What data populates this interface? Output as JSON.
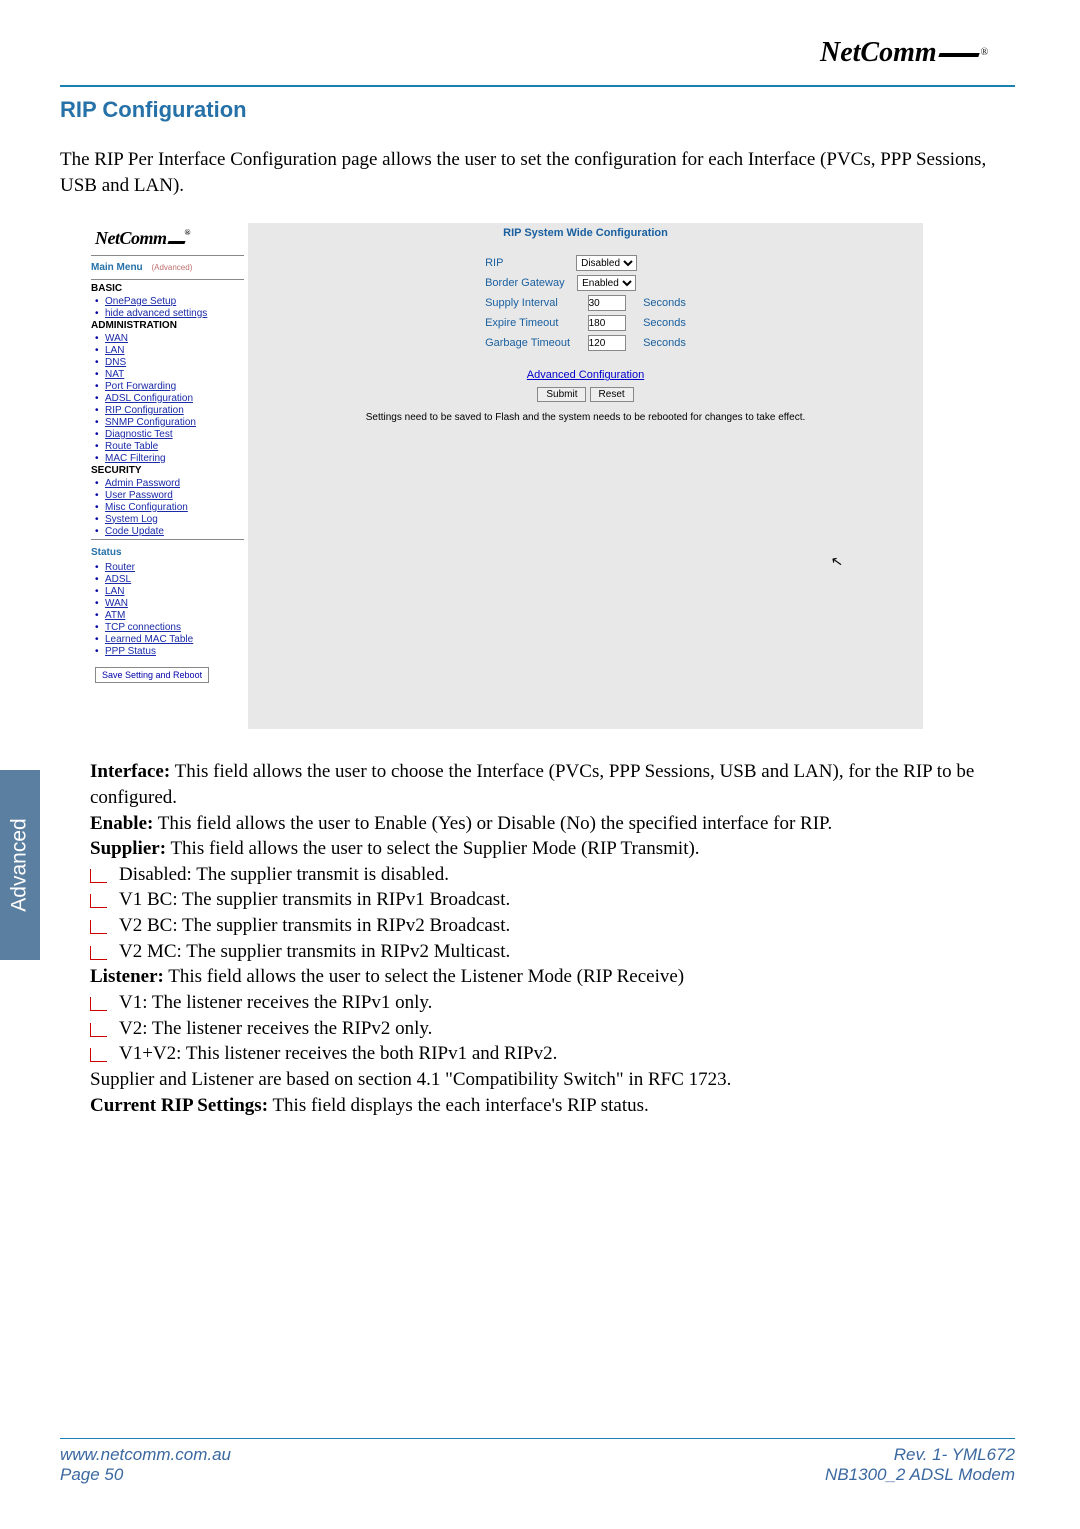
{
  "header": {
    "logo_text": "NetComm",
    "title": "RIP Configuration",
    "intro": "The RIP Per Interface Configuration page allows the user to set the configuration for each Interface (PVCs, PPP Sessions, USB and LAN)."
  },
  "screenshot": {
    "logo": "NetComm",
    "main_menu": "Main Menu",
    "main_menu_sub": "(Advanced)",
    "basic_h": "BASIC",
    "basic_items": [
      "OnePage Setup",
      "hide advanced settings"
    ],
    "admin_h": "ADMINISTRATION",
    "admin_items": [
      "WAN",
      "LAN",
      "DNS",
      "NAT",
      "Port Forwarding",
      "ADSL Configuration",
      "RIP Configuration",
      "SNMP Configuration",
      "Diagnostic Test",
      "Route Table",
      "MAC Filtering"
    ],
    "security_h": "SECURITY",
    "security_items": [
      "Admin Password",
      "User Password",
      "Misc Configuration",
      "System Log",
      "Code Update"
    ],
    "status_h": "Status",
    "status_items": [
      "Router",
      "ADSL",
      "LAN",
      "WAN",
      "ATM",
      "TCP connections",
      "Learned MAC Table",
      "PPP Status"
    ],
    "reboot_btn": "Save Setting and Reboot",
    "panel_title": "RIP System Wide Configuration",
    "rows": {
      "rip": {
        "label": "RIP",
        "value": "Disabled"
      },
      "border": {
        "label": "Border Gateway",
        "value": "Enabled"
      },
      "supply": {
        "label": "Supply Interval",
        "value": "30",
        "unit": "Seconds"
      },
      "expire": {
        "label": "Expire Timeout",
        "value": "180",
        "unit": "Seconds"
      },
      "garbage": {
        "label": "Garbage Timeout",
        "value": "120",
        "unit": "Seconds"
      }
    },
    "adv_link": "Advanced Configuration",
    "submit": "Submit",
    "reset": "Reset",
    "note": "Settings need to be saved to Flash and the system needs to be rebooted for changes to take effect."
  },
  "body": {
    "interface_label": "Interface:",
    "interface_text": "  This field allows the user to choose the Interface (PVCs, PPP Sessions, USB and LAN), for the RIP to be configured.",
    "enable_label": "Enable:",
    "enable_text": "  This field allows the user to Enable (Yes) or Disable (No) the specified interface for RIP.",
    "supplier_label": "Supplier:",
    "supplier_text": "  This field allows the user to select the Supplier Mode (RIP Transmit).",
    "supplier_bullets": [
      "Disabled: The supplier transmit is disabled.",
      "V1 BC: The supplier transmits in RIPv1 Broadcast.",
      "V2 BC: The supplier transmits in RIPv2 Broadcast.",
      "V2 MC: The supplier transmits in RIPv2 Multicast."
    ],
    "listener_label": "Listener:",
    "listener_text": "  This field allows the user to select the Listener Mode (RIP Receive)",
    "listener_bullets": [
      "V1: The listener receives the RIPv1 only.",
      "V2: The listener receives the RIPv2 only.",
      "V1+V2: This listener receives the both RIPv1 and RIPv2."
    ],
    "rfc_line": "Supplier and Listener are based on section 4.1 \"Compatibility Switch\" in RFC 1723.",
    "current_label": "Current RIP Settings:",
    "current_text": "  This field displays the each interface's RIP status."
  },
  "side_tab": "Advanced",
  "footer": {
    "url": "www.netcomm.com.au",
    "page": "Page 50",
    "rev": "Rev. 1- YML672",
    "model": "NB1300_2 ADSL Modem"
  }
}
